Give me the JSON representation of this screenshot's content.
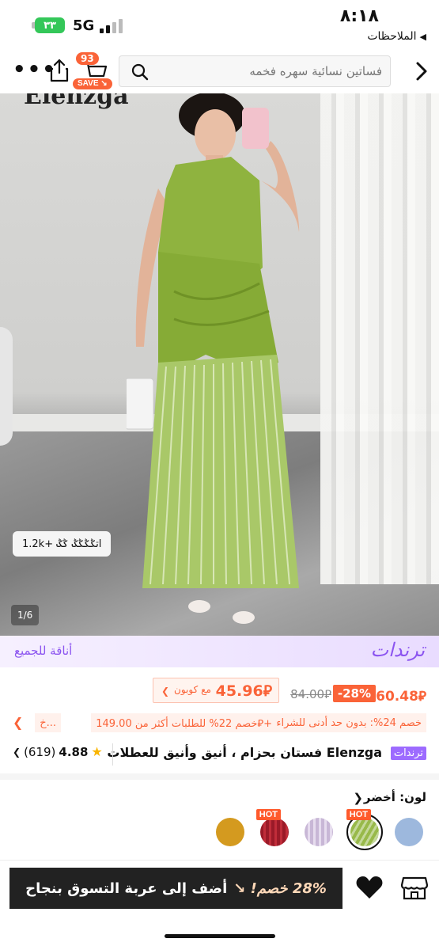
{
  "status_bar": {
    "time": "٨:١٨",
    "network": "5G",
    "battery": "٣٣",
    "back_label": "الملاحظات"
  },
  "nav": {
    "search_placeholder": "فساتين نسائية سهره فخمه",
    "cart_count": "93",
    "save_label": "SAVE"
  },
  "hero": {
    "brand_watermark": "Elenzga",
    "views_label": "1.2k+ اتݣݣݣݣ ݣݣ",
    "image_counter": "1/6"
  },
  "trends_banner": {
    "title": "ترندات",
    "subtitle": "أناقة للجميع"
  },
  "pricing": {
    "current_price": "60.48⃁",
    "discount": "-28%",
    "original_price": "84.00⃁",
    "coupon_price": "45.96⃁",
    "coupon_label": "مع كوبون"
  },
  "promos": [
    "خصم 24%: بدون حد أدنى للشراء",
    "خصم 22% للطلبات أكثر من 149.00⃁+",
    "خ..."
  ],
  "product": {
    "tag": "ترندات",
    "title": "Elenzga فستان بحزام ، أنيق وأنيق للعطلات",
    "rating": "4.88",
    "review_count": "(619)"
  },
  "color": {
    "label": "لون: أخضر",
    "swatches": [
      {
        "name": "light-blue",
        "color": "#9db8dd",
        "hot": false
      },
      {
        "name": "olive-green",
        "color": "#98b94a",
        "hot": true,
        "selected": true
      },
      {
        "name": "lilac",
        "color": "#c8b7d6",
        "hot": false
      },
      {
        "name": "burgundy",
        "color": "#9a1a28",
        "hot": true
      },
      {
        "name": "mustard",
        "color": "#d49a1f",
        "hot": false
      }
    ],
    "hot_label": "HOT"
  },
  "bottom_bar": {
    "add_to_cart_discount": "28% خصم!",
    "add_to_cart_label": "أضف إلى عربة التسوق بنجاح"
  },
  "colors": {
    "accent": "#fa6338",
    "trend_purple": "#8c55f0",
    "dark_button": "#222222"
  }
}
